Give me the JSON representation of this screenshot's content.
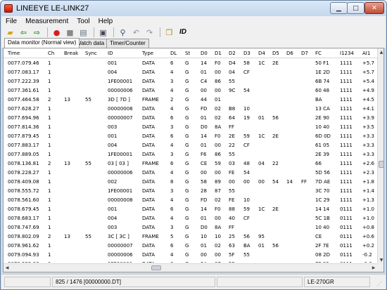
{
  "window": {
    "title": "LINEEYE LE-LINK27"
  },
  "menu": [
    "File",
    "Measurement",
    "Tool",
    "Help"
  ],
  "toolbar": {
    "id_label": "ID"
  },
  "tabs": [
    {
      "label": "Data monitor (Normal view)",
      "active": true
    },
    {
      "label": "Watch data",
      "active": false
    },
    {
      "label": "Timer/Counter",
      "active": false
    }
  ],
  "table": {
    "columns": [
      "Time",
      "Ch",
      "Break",
      "Sync",
      "ID",
      "Type",
      "DL",
      "St",
      "D0",
      "D1",
      "D2",
      "D3",
      "D4",
      "D5",
      "D6",
      "D7",
      "FC",
      "I1234",
      "AI1"
    ],
    "rows": [
      [
        "0077.079.46",
        "1",
        "",
        "",
        "001",
        "DATA",
        "6",
        "G",
        "14",
        "F0",
        "D4",
        "58",
        "1C",
        "2E",
        "",
        "",
        "50 F1",
        "1111",
        "+5.7"
      ],
      [
        "0077.083.17",
        "1",
        "",
        "",
        "004",
        "DATA",
        "4",
        "G",
        "01",
        "00",
        "04",
        "CF",
        "",
        "",
        "",
        "",
        "1E 2D",
        "1111",
        "+5.7"
      ],
      [
        "0077.222.39",
        "1",
        "",
        "",
        "1FE00001",
        "DATA",
        "3",
        "G",
        "C4",
        "86",
        "55",
        "",
        "",
        "",
        "",
        "",
        "6B 74",
        "1111",
        "+5.4"
      ],
      [
        "0077.361.61",
        "1",
        "",
        "",
        "00000006",
        "DATA",
        "4",
        "G",
        "00",
        "00",
        "9C",
        "54",
        "",
        "",
        "",
        "",
        "60 48",
        "1111",
        "+4.9"
      ],
      [
        "0077.464.58",
        "2",
        "13",
        "55",
        "3D [ 7D ]",
        "FRAME",
        "2",
        "G",
        "44",
        "01",
        "",
        "",
        "",
        "",
        "",
        "",
        "BA",
        "1111",
        "+4.5"
      ],
      [
        "0077.628.27",
        "1",
        "",
        "",
        "00000008",
        "DATA",
        "4",
        "G",
        "FD",
        "02",
        "B8",
        "10",
        "",
        "",
        "",
        "",
        "13 CA",
        "1111",
        "+4.1"
      ],
      [
        "0077.694.96",
        "1",
        "",
        "",
        "00000007",
        "DATA",
        "6",
        "G",
        "01",
        "02",
        "64",
        "19",
        "01",
        "56",
        "",
        "",
        "2E 90",
        "1111",
        "+3.9"
      ],
      [
        "0077.814.36",
        "1",
        "",
        "",
        "003",
        "DATA",
        "3",
        "G",
        "D0",
        "8A",
        "FF",
        "",
        "",
        "",
        "",
        "",
        "10 40",
        "1111",
        "+3.5"
      ],
      [
        "0077.879.45",
        "1",
        "",
        "",
        "001",
        "DATA",
        "6",
        "G",
        "14",
        "F0",
        "2E",
        "59",
        "1C",
        "2E",
        "",
        "",
        "6D 0D",
        "1111",
        "+3.3"
      ],
      [
        "0077.883.17",
        "1",
        "",
        "",
        "004",
        "DATA",
        "4",
        "G",
        "01",
        "00",
        "22",
        "CF",
        "",
        "",
        "",
        "",
        "61 05",
        "1111",
        "+3.3"
      ],
      [
        "0077.889.05",
        "1",
        "",
        "",
        "1FE00001",
        "DATA",
        "3",
        "G",
        "F6",
        "86",
        "55",
        "",
        "",
        "",
        "",
        "",
        "2E 39",
        "1111",
        "+3.3"
      ],
      [
        "0078.136.81",
        "2",
        "13",
        "55",
        "03 [ 03 ]",
        "FRAME",
        "6",
        "G",
        "CE",
        "59",
        "03",
        "48",
        "04",
        "22",
        "",
        "",
        "66",
        "1111",
        "+2.6"
      ],
      [
        "0078.228.27",
        "1",
        "",
        "",
        "00000006",
        "DATA",
        "4",
        "G",
        "00",
        "00",
        "FE",
        "54",
        "",
        "",
        "",
        "",
        "5D 56",
        "1111",
        "+2.3"
      ],
      [
        "0078.409.08",
        "1",
        "",
        "",
        "002",
        "DATA",
        "8",
        "G",
        "58",
        "89",
        "00",
        "00",
        "00",
        "54",
        "14",
        "FF",
        "7D AE",
        "1111",
        "+1.8"
      ],
      [
        "0078.555.72",
        "1",
        "",
        "",
        "1FE00001",
        "DATA",
        "3",
        "G",
        "28",
        "87",
        "55",
        "",
        "",
        "",
        "",
        "",
        "3C 70",
        "1111",
        "+1.4"
      ],
      [
        "0078.561.60",
        "1",
        "",
        "",
        "00000008",
        "DATA",
        "4",
        "G",
        "FD",
        "02",
        "FE",
        "10",
        "",
        "",
        "",
        "",
        "1C 29",
        "1111",
        "+1.3"
      ],
      [
        "0078.679.45",
        "1",
        "",
        "",
        "001",
        "DATA",
        "6",
        "G",
        "14",
        "F0",
        "88",
        "59",
        "1C",
        "2E",
        "",
        "",
        "14 14",
        "0111",
        "+1.0"
      ],
      [
        "0078.683.17",
        "1",
        "",
        "",
        "004",
        "DATA",
        "4",
        "G",
        "01",
        "00",
        "40",
        "CF",
        "",
        "",
        "",
        "",
        "5C 1B",
        "0111",
        "+1.0"
      ],
      [
        "0078.747.69",
        "1",
        "",
        "",
        "003",
        "DATA",
        "3",
        "G",
        "D0",
        "8A",
        "FF",
        "",
        "",
        "",
        "",
        "",
        "10 40",
        "0111",
        "+0.8"
      ],
      [
        "0078.802.09",
        "2",
        "13",
        "55",
        "3C [ 3C ]",
        "FRAME",
        "5",
        "G",
        "10",
        "10",
        "25",
        "56",
        "95",
        "",
        "",
        "",
        "CE",
        "0111",
        "+0.6"
      ],
      [
        "0078.961.62",
        "1",
        "",
        "",
        "00000007",
        "DATA",
        "6",
        "G",
        "01",
        "02",
        "63",
        "BA",
        "01",
        "56",
        "",
        "",
        "2F 7E",
        "0111",
        "+0.2"
      ],
      [
        "0079.094.93",
        "1",
        "",
        "",
        "00000006",
        "DATA",
        "4",
        "G",
        "00",
        "00",
        "5F",
        "55",
        "",
        "",
        "",
        "",
        "08 2D",
        "0111",
        "-0.2"
      ],
      [
        "0079.222.38",
        "1",
        "",
        "",
        "1FE00001",
        "DATA",
        "3",
        "G",
        "5A",
        "87",
        "55",
        "",
        "",
        "",
        "",
        "",
        "7F 83",
        "0111",
        "-0.6"
      ]
    ]
  },
  "status": {
    "left": "",
    "position": "825 / 1476 [00000000.DT]",
    "middle": "",
    "device": "LE-270GR"
  }
}
